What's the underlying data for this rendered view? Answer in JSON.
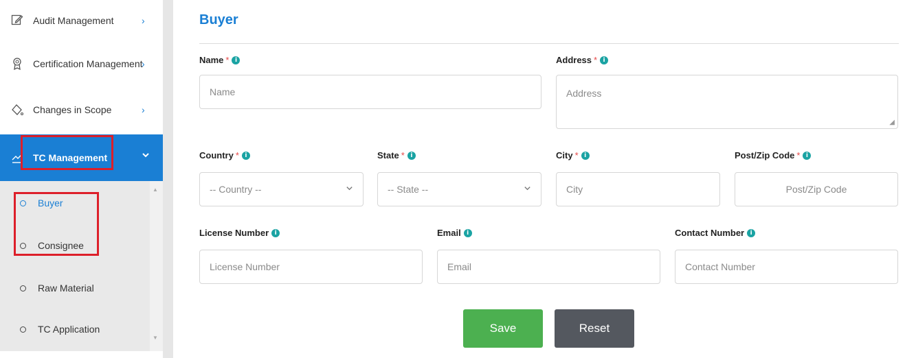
{
  "sidebar": {
    "items": [
      {
        "label": "Audit Management",
        "icon": "edit-icon"
      },
      {
        "label": "Certification Management",
        "icon": "award-icon"
      },
      {
        "label": "Changes in Scope",
        "icon": "fill-bucket-icon"
      },
      {
        "label": "TC Management",
        "icon": "trend-icon",
        "active": true
      }
    ],
    "submenu": [
      {
        "label": "Buyer",
        "current": true
      },
      {
        "label": "Consignee"
      },
      {
        "label": "Raw Material"
      },
      {
        "label": "TC Application"
      }
    ],
    "chevron_right": "›",
    "chevron_down": "⌄"
  },
  "page": {
    "title": "Buyer",
    "required_marker": "*",
    "info_glyph": "i"
  },
  "form": {
    "name": {
      "label": "Name",
      "placeholder": "Name"
    },
    "address": {
      "label": "Address",
      "placeholder": "Address"
    },
    "country": {
      "label": "Country",
      "selected": "-- Country --"
    },
    "state": {
      "label": "State",
      "selected": "-- State --"
    },
    "city": {
      "label": "City",
      "placeholder": "City"
    },
    "zip": {
      "label": "Post/Zip Code",
      "placeholder": "Post/Zip Code"
    },
    "license": {
      "label": "License Number",
      "placeholder": "License Number"
    },
    "email": {
      "label": "Email",
      "placeholder": "Email"
    },
    "contact": {
      "label": "Contact Number",
      "placeholder": "Contact Number"
    }
  },
  "actions": {
    "save": "Save",
    "reset": "Reset"
  },
  "colors": {
    "accent": "#1a7fd4",
    "save": "#4cb050",
    "reset": "#54585f",
    "highlight": "#dd1f2a"
  }
}
